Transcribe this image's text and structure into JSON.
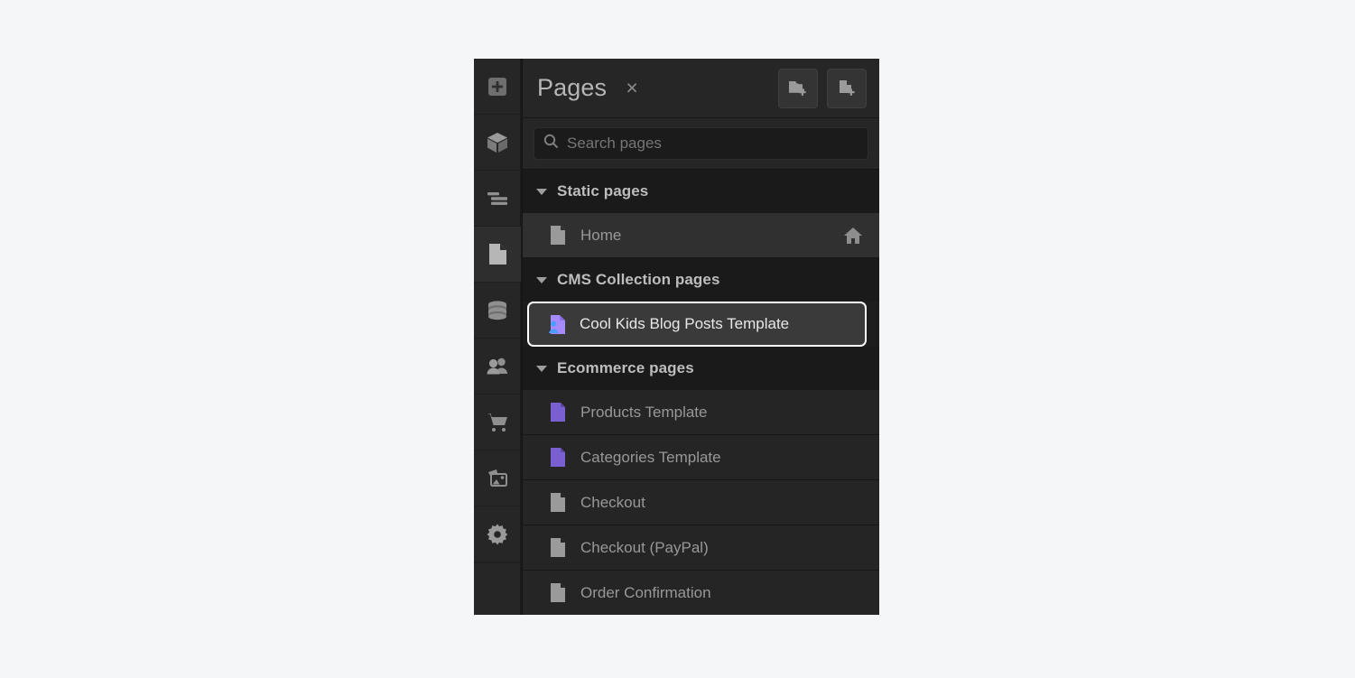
{
  "rail": {
    "items": [
      {
        "name": "add-panel-icon",
        "label": "Add elements",
        "active": false
      },
      {
        "name": "components-icon",
        "label": "Components",
        "active": false
      },
      {
        "name": "navigator-icon",
        "label": "Navigator",
        "active": false
      },
      {
        "name": "pages-icon",
        "label": "Pages",
        "active": true
      },
      {
        "name": "cms-database-icon",
        "label": "CMS",
        "active": false
      },
      {
        "name": "users-icon",
        "label": "Users",
        "active": false
      },
      {
        "name": "ecommerce-cart-icon",
        "label": "Ecommerce",
        "active": false
      },
      {
        "name": "assets-image-icon",
        "label": "Assets",
        "active": false
      },
      {
        "name": "settings-gear-icon",
        "label": "Settings",
        "active": false
      }
    ]
  },
  "panel": {
    "title": "Pages",
    "close_label": "×",
    "buttons": [
      {
        "name": "new-folder-button",
        "label": "New folder"
      },
      {
        "name": "new-page-button",
        "label": "New page"
      }
    ],
    "search": {
      "placeholder": "Search pages",
      "value": "",
      "icon": "search-icon"
    },
    "sections": [
      {
        "label": "Static pages",
        "expanded": true,
        "rows": [
          {
            "label": "Home",
            "icon": "page-icon",
            "icon_color": "#9a9a9a",
            "state": "hovered",
            "badge_icon": "home-icon"
          }
        ]
      },
      {
        "label": "CMS Collection pages",
        "expanded": true,
        "rows": [
          {
            "label": "Cool Kids Blog Posts Template",
            "icon": "cms-template-page-icon",
            "icon_color": "#a78bfa",
            "icon_accent_color": "#4a9eff",
            "state": "selected",
            "badge_icon": ""
          }
        ]
      },
      {
        "label": "Ecommerce pages",
        "expanded": true,
        "rows": [
          {
            "label": "Products Template",
            "icon": "template-page-icon",
            "icon_color": "#7a5fd0",
            "state": "normal",
            "badge_icon": ""
          },
          {
            "label": "Categories Template",
            "icon": "template-page-icon",
            "icon_color": "#7a5fd0",
            "state": "normal",
            "badge_icon": ""
          },
          {
            "label": "Checkout",
            "icon": "page-icon",
            "icon_color": "#9a9a9a",
            "state": "normal",
            "badge_icon": ""
          },
          {
            "label": "Checkout (PayPal)",
            "icon": "page-icon",
            "icon_color": "#9a9a9a",
            "state": "normal",
            "badge_icon": ""
          },
          {
            "label": "Order Confirmation",
            "icon": "page-icon",
            "icon_color": "#9a9a9a",
            "state": "normal",
            "badge_icon": ""
          }
        ]
      }
    ]
  },
  "colors": {
    "panel_bg": "#1d1d1d",
    "header_bg": "#262626",
    "row_bg": "#252525",
    "row_hover_bg": "#303030",
    "section_bg": "#1a1a1a",
    "selection_border": "#ffffff",
    "cms_purple": "#a78bfa",
    "cms_blue": "#4a9eff",
    "template_purple": "#7a5fd0"
  }
}
